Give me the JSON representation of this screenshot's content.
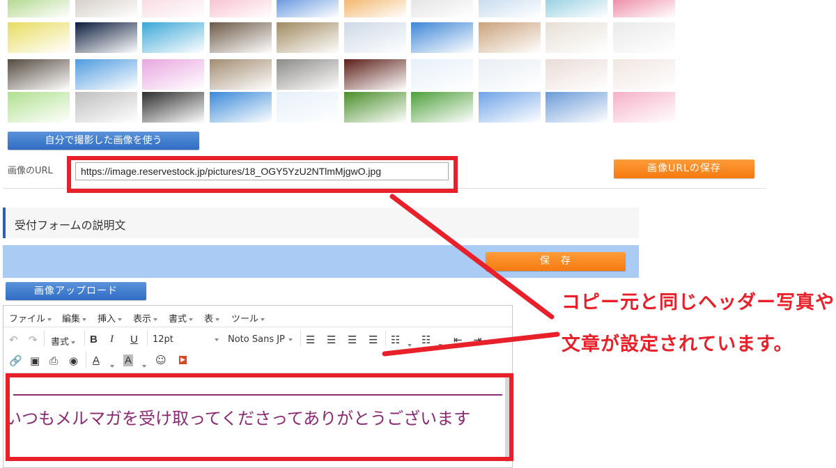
{
  "thumbnails": [
    [
      "#9ccd6d",
      "#c8c0b6",
      "#f5d2dc",
      "#f6b0c4",
      "#3b7bd6",
      "#f0a040",
      "#dcdcdc",
      "#b7d1ea",
      "#79c2d8",
      "#e96b8e"
    ],
    [
      "#e8dc60",
      "#0c1d3c",
      "#3ca7d8",
      "#6d5a48",
      "#a08a60",
      "#cdd9e6",
      "#3e86d6",
      "#caa27c",
      "#e6e0d6",
      "#eaeaea"
    ],
    [
      "#554b40",
      "#4f9be0",
      "#e8a6e0",
      "#a38c72",
      "#8d8b88",
      "#5c1f18",
      "#e6f0f8",
      "#e8eef4",
      "#eadcd8",
      "#f0e6e2"
    ],
    [
      "#b0e090",
      "#bfbfbf",
      "#2e2e2e",
      "#3a8ad8",
      "#e6f0fa",
      "#4a8e2a",
      "#4fa03c",
      "#6fa3e8",
      "#6b9bd8",
      "#f6b0c8"
    ]
  ],
  "own_image_button": "自分で撮影した画像を使う",
  "url_label": "画像のURL",
  "url_value": "https://image.reservestock.jp/pictures/18_OGY5YzU2NTlmMjgwO.jpg",
  "save_url_button": "画像URLの保存",
  "section_title": "受付フォームの説明文",
  "save_button": "保　存",
  "upload_button": "画像アップロード",
  "editor": {
    "menus": [
      "ファイル",
      "編集",
      "挿入",
      "表示",
      "書式",
      "表",
      "ツール"
    ],
    "format_select": "書式",
    "size_select": "12pt",
    "font_select": "Noto Sans JP",
    "content_text": "いつもメルマガを受け取ってくださってありがとうございます"
  },
  "callout": {
    "line1": "コピー元と同じヘッダー写真や",
    "line2": "文章が設定されています。"
  }
}
